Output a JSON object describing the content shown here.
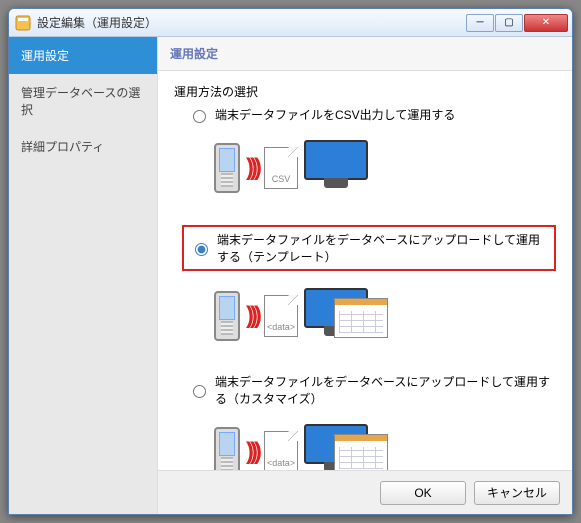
{
  "window": {
    "title": "設定編集（運用設定）"
  },
  "sidebar": {
    "items": [
      {
        "label": "運用設定",
        "selected": true
      },
      {
        "label": "管理データベースの選択",
        "selected": false
      },
      {
        "label": "詳細プロパティ",
        "selected": false
      }
    ]
  },
  "main": {
    "header": "運用設定",
    "section_label": "運用方法の選択",
    "options": [
      {
        "label": "端末データファイルをCSV出力して運用する",
        "checked": false,
        "highlight": false,
        "file_tag": "CSV",
        "has_overlay": false
      },
      {
        "label": "端末データファイルをデータベースにアップロードして運用する（テンプレート）",
        "checked": true,
        "highlight": true,
        "file_tag": "<data>",
        "has_overlay": true
      },
      {
        "label": "端末データファイルをデータベースにアップロードして運用する（カスタマイズ）",
        "checked": false,
        "highlight": false,
        "file_tag": "<data>",
        "has_overlay": true
      }
    ]
  },
  "footer": {
    "ok": "OK",
    "cancel": "キャンセル"
  }
}
